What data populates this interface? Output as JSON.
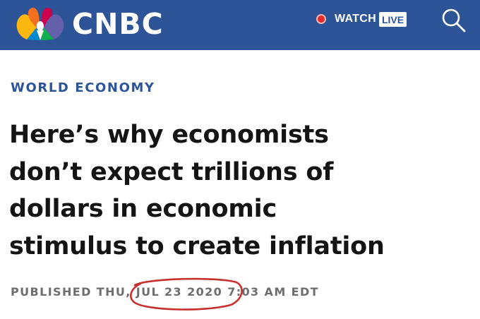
{
  "header": {
    "brand": "CNBC",
    "watch_label": "WATCH",
    "live_badge": "LIVE",
    "brand_color": "#2d5496",
    "live_dot_color": "#e32b2b",
    "search_icon": "search-icon"
  },
  "article": {
    "section": "WORLD ECONOMY",
    "headline_lines": [
      "Here’s why economists",
      "don’t expect trillions of",
      "dollars in economic",
      "stimulus to create inflation"
    ],
    "published_prefix": "PUBLISHED THU,",
    "published_date": "JUL 23 2020",
    "published_time": "7:03 AM EDT",
    "annotation_color": "#c8302e"
  }
}
